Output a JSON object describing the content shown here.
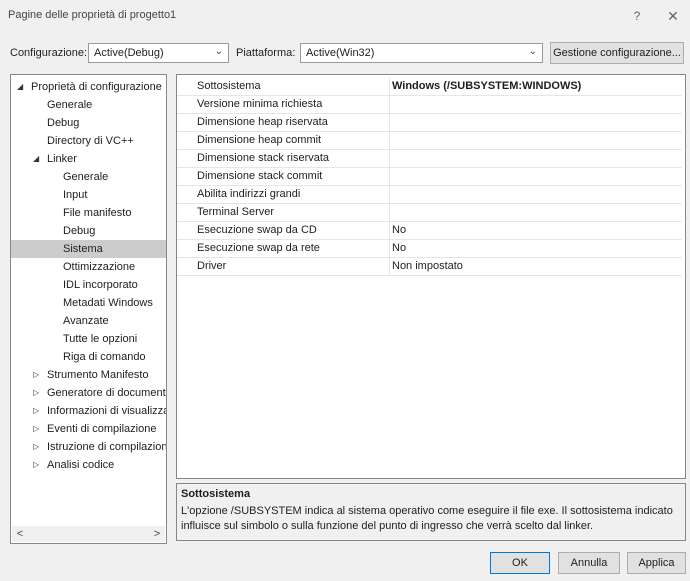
{
  "window": {
    "title": "Pagine delle proprietà di progetto1",
    "help": "?",
    "close": "✕"
  },
  "toolbar": {
    "config_label": "Configurazione:",
    "config_value": "Active(Debug)",
    "platform_label": "Piattaforma:",
    "platform_value": "Active(Win32)",
    "manage_button": "Gestione configurazione..."
  },
  "tree": {
    "items": [
      {
        "label": "Proprietà di configurazione",
        "expander": "◢"
      },
      {
        "label": "Generale"
      },
      {
        "label": "Debug"
      },
      {
        "label": "Directory di VC++"
      },
      {
        "label": "Linker",
        "expander": "◢"
      },
      {
        "label": "Generale"
      },
      {
        "label": "Input"
      },
      {
        "label": "File manifesto"
      },
      {
        "label": "Debug"
      },
      {
        "label": "Sistema"
      },
      {
        "label": "Ottimizzazione"
      },
      {
        "label": "IDL incorporato"
      },
      {
        "label": "Metadati Windows"
      },
      {
        "label": "Avanzate"
      },
      {
        "label": "Tutte le opzioni"
      },
      {
        "label": "Riga di comando"
      },
      {
        "label": "Strumento Manifesto",
        "expander": "▷"
      },
      {
        "label": "Generatore di documenti X",
        "expander": "▷"
      },
      {
        "label": "Informazioni di visualizzazi",
        "expander": "▷"
      },
      {
        "label": "Eventi di compilazione",
        "expander": "▷"
      },
      {
        "label": "Istruzione di compilazione",
        "expander": "▷"
      },
      {
        "label": "Analisi codice",
        "expander": "▷"
      }
    ],
    "scroll_left": "<",
    "scroll_right": ">"
  },
  "properties": [
    {
      "name": "Sottosistema",
      "value": "Windows (/SUBSYSTEM:WINDOWS)"
    },
    {
      "name": "Versione minima richiesta",
      "value": ""
    },
    {
      "name": "Dimensione heap riservata",
      "value": ""
    },
    {
      "name": "Dimensione heap commit",
      "value": ""
    },
    {
      "name": "Dimensione stack riservata",
      "value": ""
    },
    {
      "name": "Dimensione stack commit",
      "value": ""
    },
    {
      "name": "Abilita indirizzi grandi",
      "value": ""
    },
    {
      "name": "Terminal Server",
      "value": ""
    },
    {
      "name": "Esecuzione swap da CD",
      "value": "No"
    },
    {
      "name": "Esecuzione swap da rete",
      "value": "No"
    },
    {
      "name": "Driver",
      "value": "Non impostato"
    }
  ],
  "description": {
    "title": "Sottosistema",
    "text": "L'opzione /SUBSYSTEM indica al sistema operativo come eseguire il file exe. Il sottosistema indicato influisce sul simbolo o sulla funzione del punto di ingresso che verrà scelto dal linker."
  },
  "buttons": {
    "ok": "OK",
    "cancel": "Annulla",
    "apply": "Applica"
  }
}
